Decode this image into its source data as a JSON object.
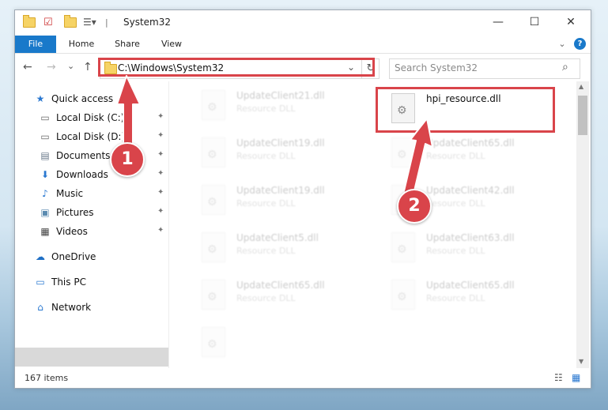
{
  "window": {
    "title": "System32",
    "min_glyph": "—",
    "max_glyph": "☐",
    "close_glyph": "✕"
  },
  "ribbon": {
    "tabs": [
      "File",
      "Home",
      "Share",
      "View"
    ],
    "chevron": "⌄",
    "help": "?"
  },
  "nav": {
    "back": "←",
    "forward": "→",
    "recent": "⌄",
    "up": "↑",
    "address": "C:\\Windows\\System32",
    "refresh": "↻",
    "search_placeholder": "Search System32",
    "search_glyph": "⌕"
  },
  "sidebar": {
    "items": [
      {
        "label": "Quick access",
        "icon": "★"
      },
      {
        "label": "Local Disk (C:)",
        "icon": "▭"
      },
      {
        "label": "Local Disk (D:)",
        "icon": "▭"
      },
      {
        "label": "Documents",
        "icon": "▤"
      },
      {
        "label": "Downloads",
        "icon": "⬇"
      },
      {
        "label": "Music",
        "icon": "♪"
      },
      {
        "label": "Pictures",
        "icon": "▣"
      },
      {
        "label": "Videos",
        "icon": "▦"
      },
      {
        "label": "OneDrive",
        "icon": "☁"
      },
      {
        "label": "This PC",
        "icon": "▭"
      },
      {
        "label": "Network",
        "icon": "⌂"
      }
    ],
    "pin_glyph": "📌"
  },
  "files": {
    "highlighted": {
      "name": "hpi_resource.dll",
      "type": ""
    },
    "left_column": [
      {
        "name": "UpdateClient21.dll",
        "type": "Resource DLL"
      },
      {
        "name": "UpdateClient19.dll",
        "type": "Resource DLL"
      },
      {
        "name": "UpdateClient19.dll",
        "type": "Resource DLL"
      },
      {
        "name": "UpdateClient5.dll",
        "type": "Resource DLL"
      },
      {
        "name": "UpdateClient65.dll",
        "type": "Resource DLL"
      },
      {
        "name": "",
        "type": ""
      }
    ],
    "right_column": [
      {
        "name": "UpdateClient65.dll",
        "type": "Resource DLL"
      },
      {
        "name": "UpdateClient42.dll",
        "type": "Resource DLL"
      },
      {
        "name": "UpdateClient63.dll",
        "type": "Resource DLL"
      },
      {
        "name": "UpdateClient65.dll",
        "type": "Resource DLL"
      }
    ]
  },
  "status": {
    "count": "167 items"
  },
  "annotations": {
    "step1": "1",
    "step2": "2",
    "color": "#d9444a"
  }
}
